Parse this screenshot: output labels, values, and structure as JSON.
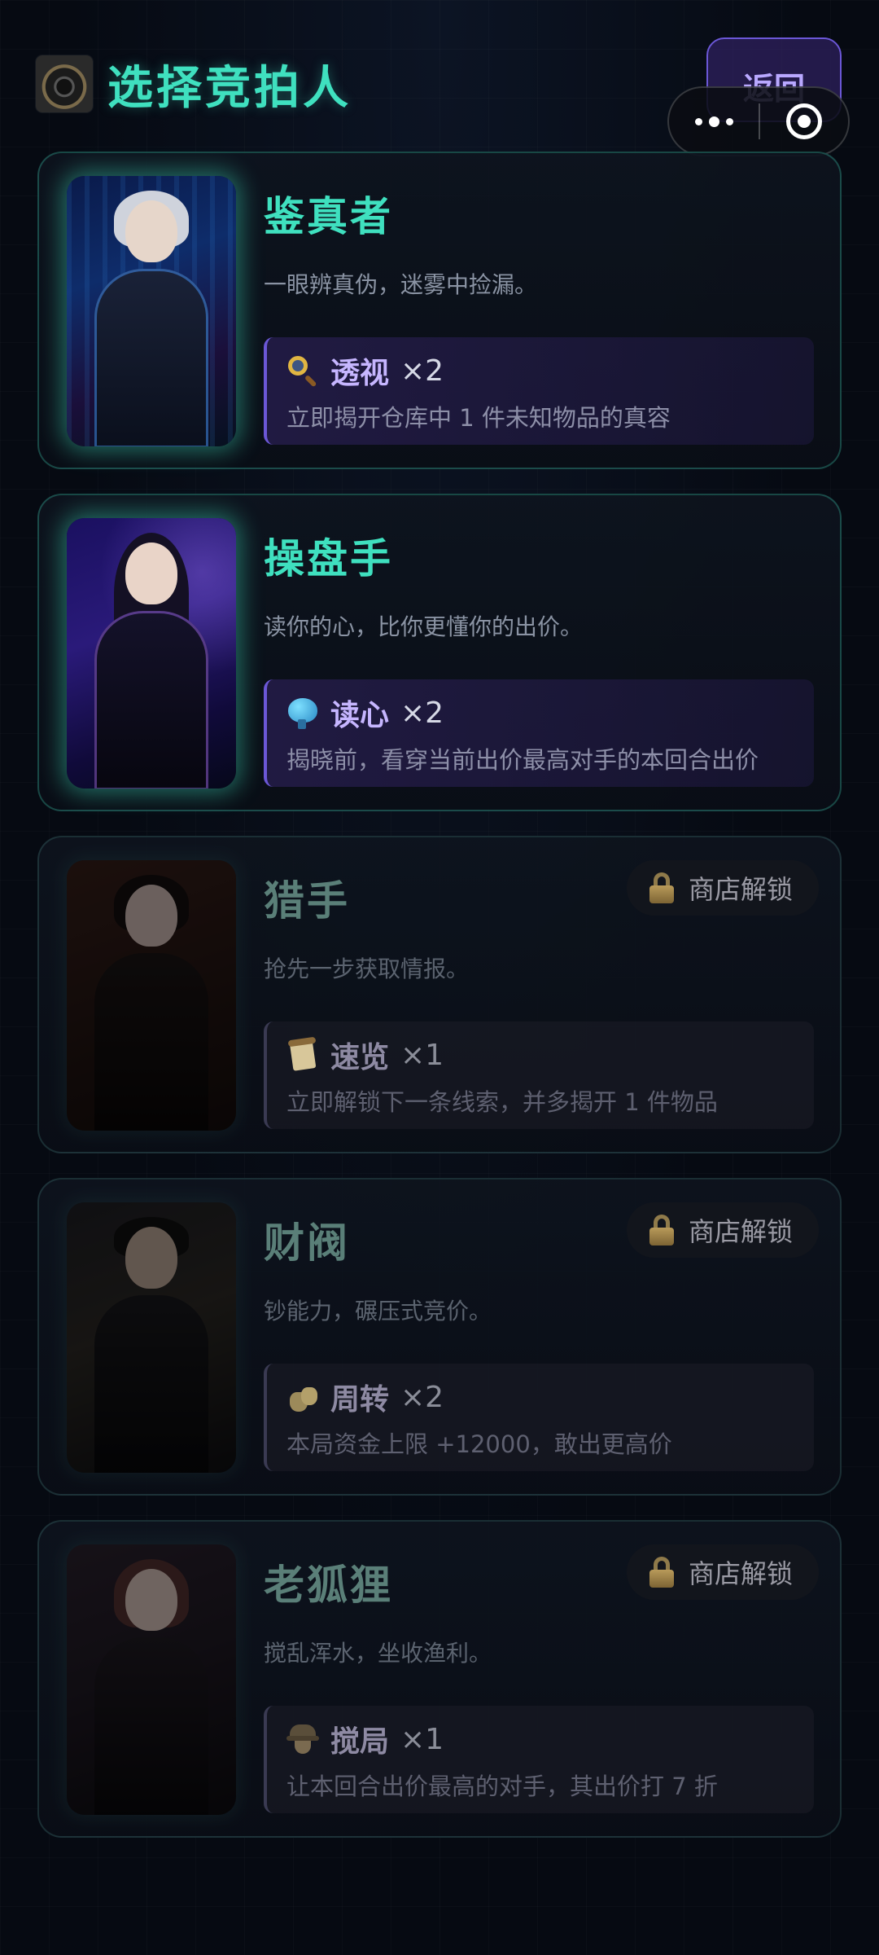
{
  "header": {
    "title": "选择竞拍人",
    "back_label": "返回"
  },
  "cards": [
    {
      "name": "鉴真者",
      "description": "一眼辨真伪，迷雾中捡漏。",
      "skill": {
        "icon": "magnifier-icon",
        "name": "透视",
        "count": "×2",
        "description": "立即揭开仓库中 1 件未知物品的真容"
      },
      "locked": false
    },
    {
      "name": "操盘手",
      "description": "读你的心，比你更懂你的出价。",
      "skill": {
        "icon": "brain-icon",
        "name": "读心",
        "count": "×2",
        "description": "揭晓前，看穿当前出价最高对手的本回合出价"
      },
      "locked": false
    },
    {
      "name": "猎手",
      "description": "抢先一步获取情报。",
      "skill": {
        "icon": "scroll-icon",
        "name": "速览",
        "count": "×1",
        "description": "立即解锁下一条线索，并多揭开 1 件物品"
      },
      "locked": true,
      "lock_label": "商店解锁"
    },
    {
      "name": "财阀",
      "description": "钞能力，碾压式竞价。",
      "skill": {
        "icon": "money-bags-icon",
        "name": "周转",
        "count": "×2",
        "description": "本局资金上限 +12000，敢出更高价"
      },
      "locked": true,
      "lock_label": "商店解锁"
    },
    {
      "name": "老狐狸",
      "description": "搅乱浑水，坐收渔利。",
      "skill": {
        "icon": "spy-icon",
        "name": "搅局",
        "count": "×1",
        "description": "让本回合出价最高的对手，其出价打 7 折"
      },
      "locked": true,
      "lock_label": "商店解锁"
    }
  ],
  "colors": {
    "accent": "#3fe0bf",
    "skill_accent": "#6b57d6",
    "background": "#060a12"
  }
}
